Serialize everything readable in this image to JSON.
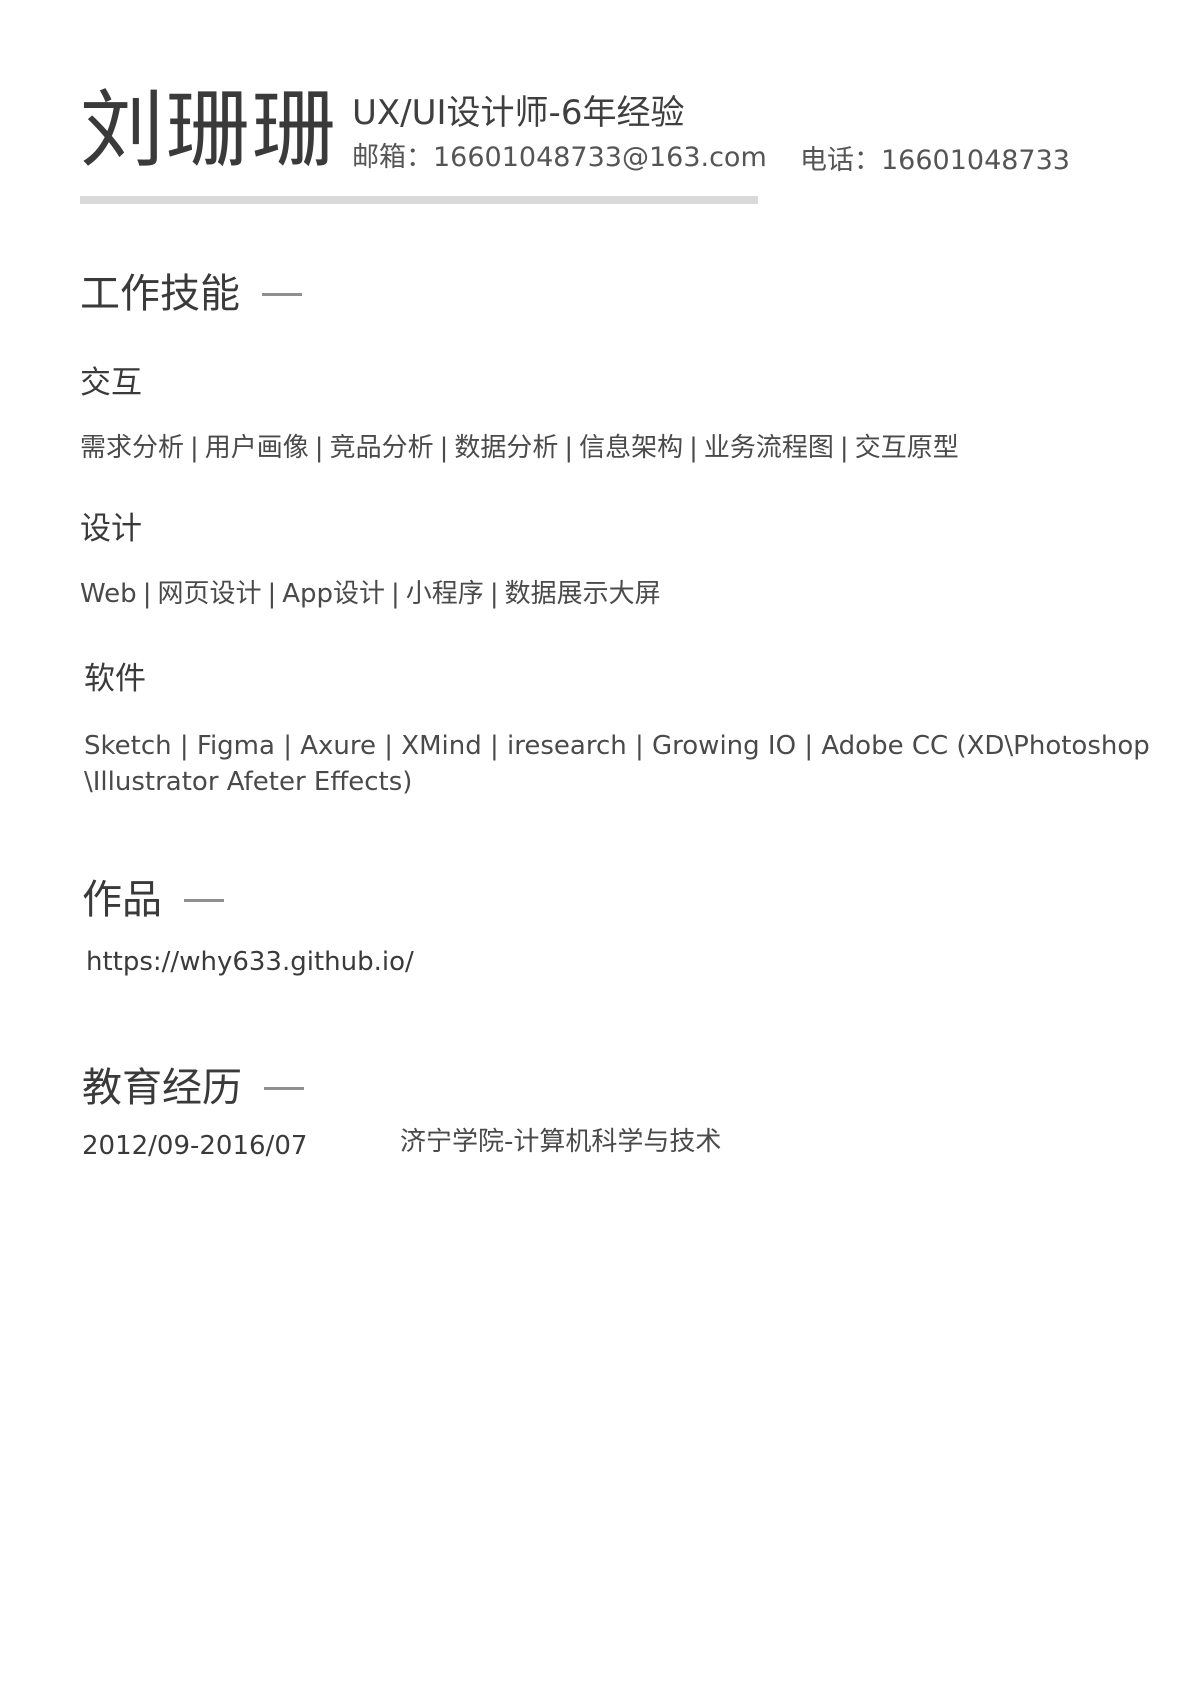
{
  "header": {
    "name": "刘珊珊",
    "title": "UX/UI设计师-6年经验",
    "email": "邮箱：16601048733@163.com",
    "phone": "电话：16601048733"
  },
  "skills": {
    "heading": "工作技能",
    "interaction": {
      "heading": "交互",
      "items": [
        "需求分析",
        "用户画像",
        "竞品分析",
        "数据分析",
        "信息架构",
        "业务流程图",
        "交互原型"
      ]
    },
    "design": {
      "heading": "设计",
      "items": [
        "Web",
        "网页设计",
        "App设计",
        "小程序",
        "数据展示大屏"
      ]
    },
    "software": {
      "heading": "软件",
      "line1": "Sketch | Figma | Axure | XMind | iresearch | Growing IO | Adobe CC (XD\\Photoshop",
      "line2": "\\Illustrator Afeter Effects)"
    }
  },
  "works": {
    "heading": "作品",
    "link": "https://why633.github.io/"
  },
  "education": {
    "heading": "教育经历",
    "period": "2012/09-2016/07",
    "school": "济宁学院-计算机科学与技术"
  }
}
